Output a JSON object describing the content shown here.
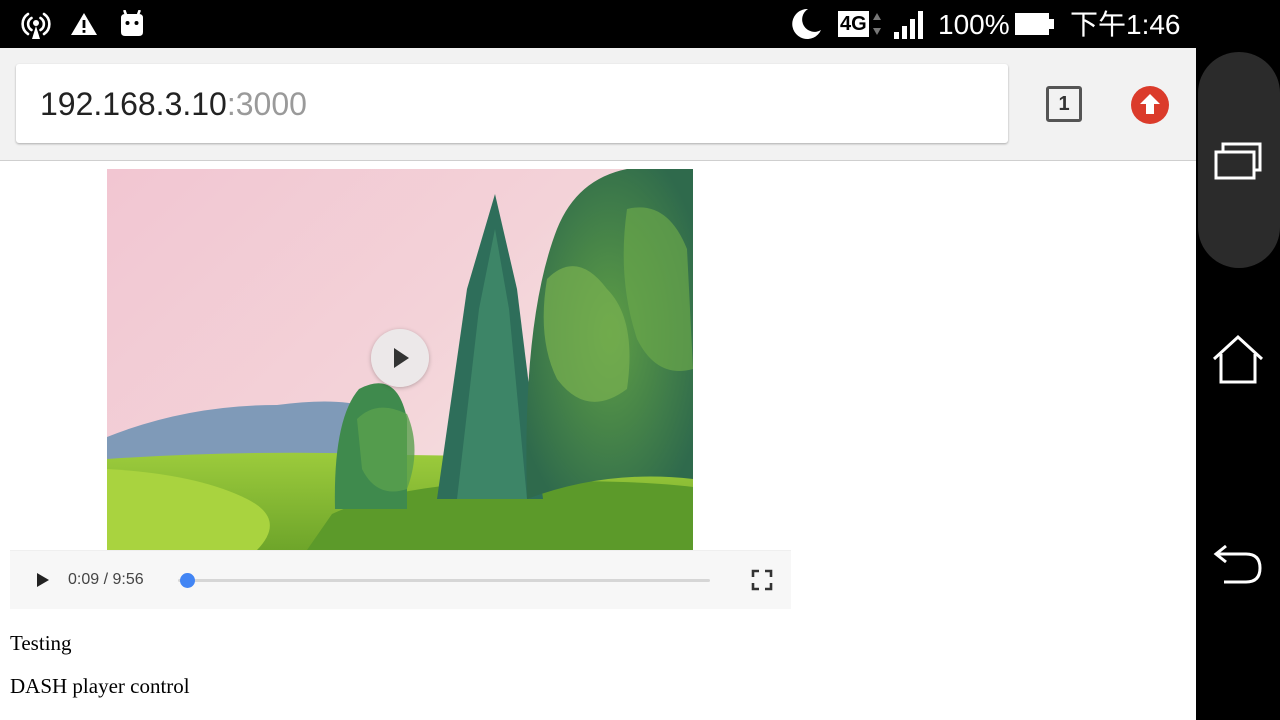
{
  "status_bar": {
    "network_type": "4G",
    "battery_percent": "100%",
    "time": "下午1:46",
    "icons": [
      "wireless-hotspot-icon",
      "warning-icon",
      "android-icon",
      "moon-icon",
      "4g-data-arrows-icon",
      "signal-bars-icon",
      "battery-icon"
    ],
    "battery_level": 1.0
  },
  "browser": {
    "url_host": "192.168.3.10",
    "url_port": ":3000",
    "tab_count": "1",
    "update_icon": "update-arrow-icon",
    "accent_update": "#db3b2b"
  },
  "video": {
    "current_time": "0:09",
    "separator": " / ",
    "duration": "9:56",
    "progress": 0.016,
    "accent": "#4285f4",
    "icons": [
      "big-play-icon",
      "play-icon",
      "fullscreen-icon"
    ]
  },
  "content": {
    "lines": [
      "Testing",
      "DASH player control"
    ]
  },
  "nav_bar": {
    "icons": [
      "recents-icon",
      "home-icon",
      "back-icon"
    ]
  }
}
